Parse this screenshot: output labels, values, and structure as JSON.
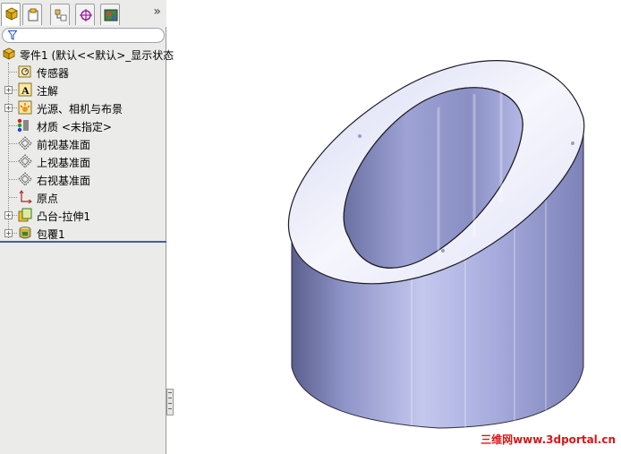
{
  "feature_manager": {
    "tabs": [
      {
        "icon": "feature-tree-icon",
        "active": true
      },
      {
        "icon": "property-manager-icon",
        "active": false
      },
      {
        "icon": "configuration-manager-icon",
        "active": false
      },
      {
        "icon": "dimxpert-icon",
        "active": false
      },
      {
        "icon": "display-manager-icon",
        "active": false
      }
    ],
    "more_label": "»",
    "filter_icon": "filter-icon",
    "root_label": "零件1  (默认<<默认>_显示状态",
    "items": [
      {
        "label": "传感器",
        "icon": "sensor-icon",
        "expandable": false
      },
      {
        "label": "注解",
        "icon": "annotation-icon",
        "expandable": true
      },
      {
        "label": "光源、相机与布景",
        "icon": "lights-icon",
        "expandable": true
      },
      {
        "label": "材质 <未指定>",
        "icon": "material-icon",
        "expandable": false
      },
      {
        "label": "前视基准面",
        "icon": "plane-icon",
        "expandable": false
      },
      {
        "label": "上视基准面",
        "icon": "plane-icon",
        "expandable": false
      },
      {
        "label": "右视基准面",
        "icon": "plane-icon",
        "expandable": false
      },
      {
        "label": "原点",
        "icon": "origin-icon",
        "expandable": false
      },
      {
        "label": "凸台-拉伸1",
        "icon": "extrude-icon",
        "expandable": true
      },
      {
        "label": "包覆1",
        "icon": "wrap-icon",
        "expandable": true
      }
    ]
  },
  "watermark": "三维网www.3dportal.cn",
  "colors": {
    "selection_line": "#3e5fa8",
    "watermark": "#d61818",
    "part_body": "#9aa0d6"
  }
}
